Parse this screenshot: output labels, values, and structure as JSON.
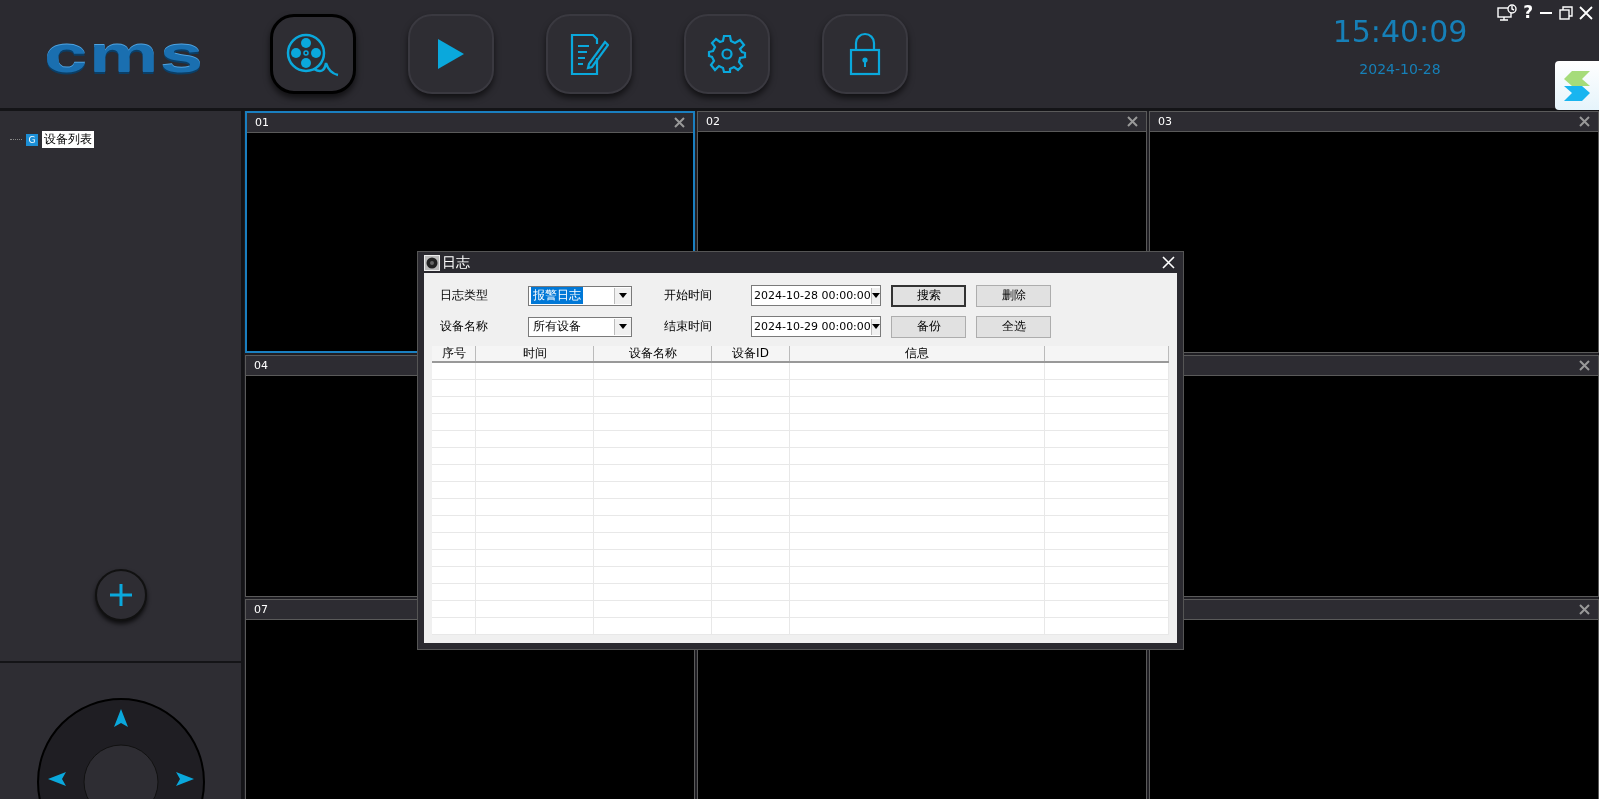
{
  "header": {
    "logo": "cms",
    "nav": [
      {
        "selected": true
      },
      {
        "selected": false
      },
      {
        "selected": false
      },
      {
        "selected": false
      },
      {
        "selected": false
      }
    ],
    "clock": {
      "time": "15:40:09",
      "date": "2024-10-28"
    },
    "help": "?"
  },
  "sidebar": {
    "tree": [
      {
        "badge": "G",
        "label": "设备列表",
        "selected": true
      }
    ]
  },
  "tiles": [
    {
      "label": "01",
      "selected": true,
      "close_icon": true
    },
    {
      "label": "02",
      "selected": false,
      "close_icon": true
    },
    {
      "label": "03",
      "selected": false,
      "close_icon": true
    },
    {
      "label": "04",
      "selected": false
    },
    {
      "selected": false,
      "close_icon": true
    },
    {
      "label": "07",
      "selected": false
    },
    {
      "selected": false
    },
    {
      "selected": false,
      "close_icon": true
    }
  ],
  "dialog": {
    "title": "日志",
    "rows": [
      {
        "label": "日志类型",
        "select": {
          "value": "报警日志",
          "highlighted": true
        },
        "time_label": "开始时间",
        "time": "2024-10-28 00:00:00",
        "buttons": [
          {
            "label": "搜索",
            "focused": true
          },
          {
            "label": "删除",
            "focused": false
          }
        ]
      },
      {
        "label": "设备名称",
        "select": {
          "value": "所有设备",
          "highlighted": false
        },
        "time_label": "结束时间",
        "time": "2024-10-29 00:00:00",
        "buttons": [
          {
            "label": "备份",
            "focused": false
          },
          {
            "label": "全选",
            "focused": false
          }
        ]
      }
    ],
    "table": {
      "columns": [
        "序号",
        "时间",
        "设备名称",
        "设备ID",
        "信息"
      ]
    }
  }
}
